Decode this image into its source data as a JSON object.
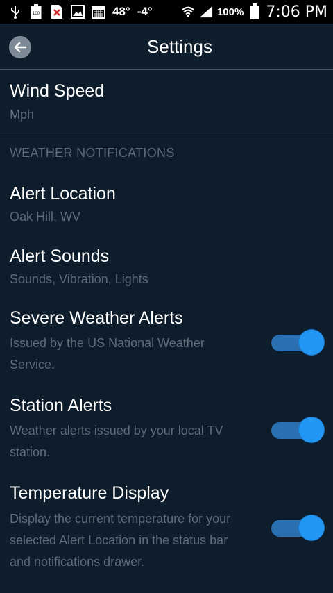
{
  "status_bar": {
    "temp1": "48°",
    "temp2": "-4°",
    "battery_pct": "100%",
    "time": "7:06 PM",
    "icons": [
      "usb-icon",
      "battery-100-icon",
      "no-sim-icon",
      "image-icon",
      "calendar-icon",
      "wifi-icon",
      "signal-icon",
      "battery-icon"
    ]
  },
  "app_bar": {
    "title": "Settings",
    "back_icon": "arrow-left-icon"
  },
  "settings": {
    "wind_speed": {
      "title": "Wind Speed",
      "value": "Mph"
    },
    "section_header": "WEATHER NOTIFICATIONS",
    "alert_location": {
      "title": "Alert Location",
      "value": "Oak Hill, WV"
    },
    "alert_sounds": {
      "title": "Alert Sounds",
      "value": "Sounds, Vibration, Lights"
    },
    "severe_alerts": {
      "title": "Severe Weather Alerts",
      "desc_line1": "Issued by the US National Weather",
      "desc_line2": "Service.",
      "enabled": true
    },
    "station_alerts": {
      "title": "Station Alerts",
      "desc_line1": "Weather alerts issued by your local TV",
      "desc_line2": "station.",
      "enabled": true
    },
    "temperature_display": {
      "title": "Temperature Display",
      "desc_line1": "Display the current temperature for your",
      "desc_line2": "selected Alert Location in the status bar",
      "desc_line3": "and notifications drawer.",
      "enabled": true
    }
  },
  "colors": {
    "background": "#0e1d2c",
    "accent": "#2196f3",
    "secondary_text": "#5d6c79"
  }
}
